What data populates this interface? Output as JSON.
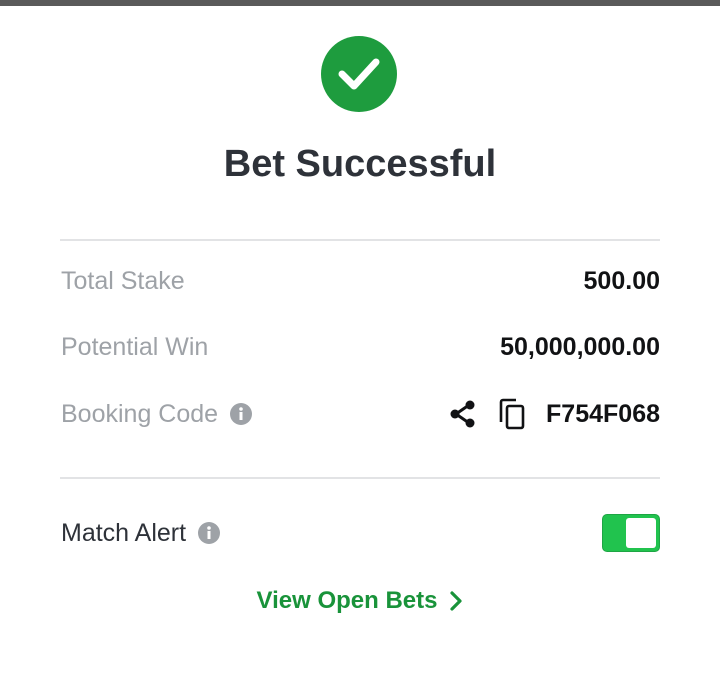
{
  "dialog": {
    "title": "Bet Successful",
    "success_color": "#1e9c3e",
    "accent_color": "#21c34e"
  },
  "summary": {
    "total_stake_label": "Total Stake",
    "total_stake_value": "500.00",
    "potential_win_label": "Potential Win",
    "potential_win_value": "50,000,000.00",
    "booking_code_label": "Booking Code",
    "booking_code_value": "F754F068"
  },
  "match_alert": {
    "label": "Match Alert",
    "enabled": true
  },
  "footer": {
    "view_open_bets_label": "View Open Bets"
  }
}
